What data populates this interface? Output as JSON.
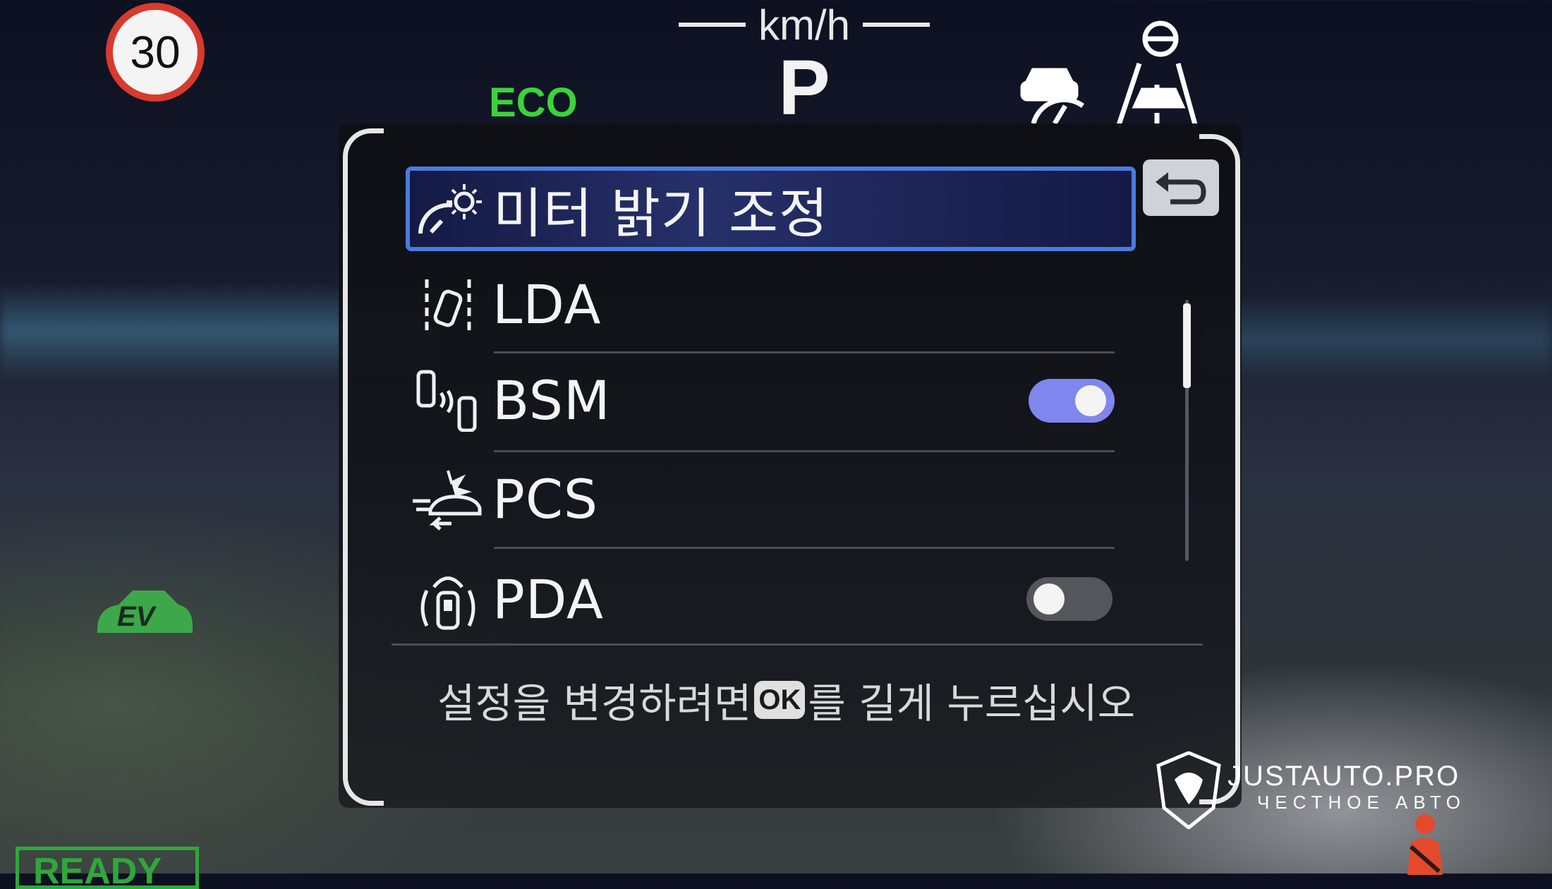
{
  "cluster": {
    "speed_limit": "30",
    "speed_unit": "km/h",
    "gear": "P",
    "drive_mode": "ECO",
    "ev_badge": "EV",
    "ready_label": "READY"
  },
  "menu": {
    "items": [
      {
        "label": "미터 밝기 조정",
        "icon": "meter-brightness-icon",
        "selected": true
      },
      {
        "label": "LDA",
        "icon": "lane-departure-icon",
        "selected": false
      },
      {
        "label": "BSM",
        "icon": "blind-spot-icon",
        "selected": false,
        "toggle": "on"
      },
      {
        "label": "PCS",
        "icon": "pre-collision-icon",
        "selected": false
      },
      {
        "label": "PDA",
        "icon": "proactive-driving-icon",
        "selected": false,
        "toggle": "off"
      }
    ],
    "hint_before": "설정을 변경하려면",
    "hint_badge": "OK",
    "hint_after": "를 길게 누르십시오"
  },
  "watermark": {
    "title": "JUSTAUTO.PRO",
    "subtitle": "ЧЕСТНОЕ АВТО"
  },
  "colors": {
    "selection_border": "#4a7be0",
    "toggle_on": "#7f86ee",
    "toggle_off": "#54565c",
    "eco_green": "#3bd33b",
    "speed_sign_red": "#d83a2e"
  }
}
